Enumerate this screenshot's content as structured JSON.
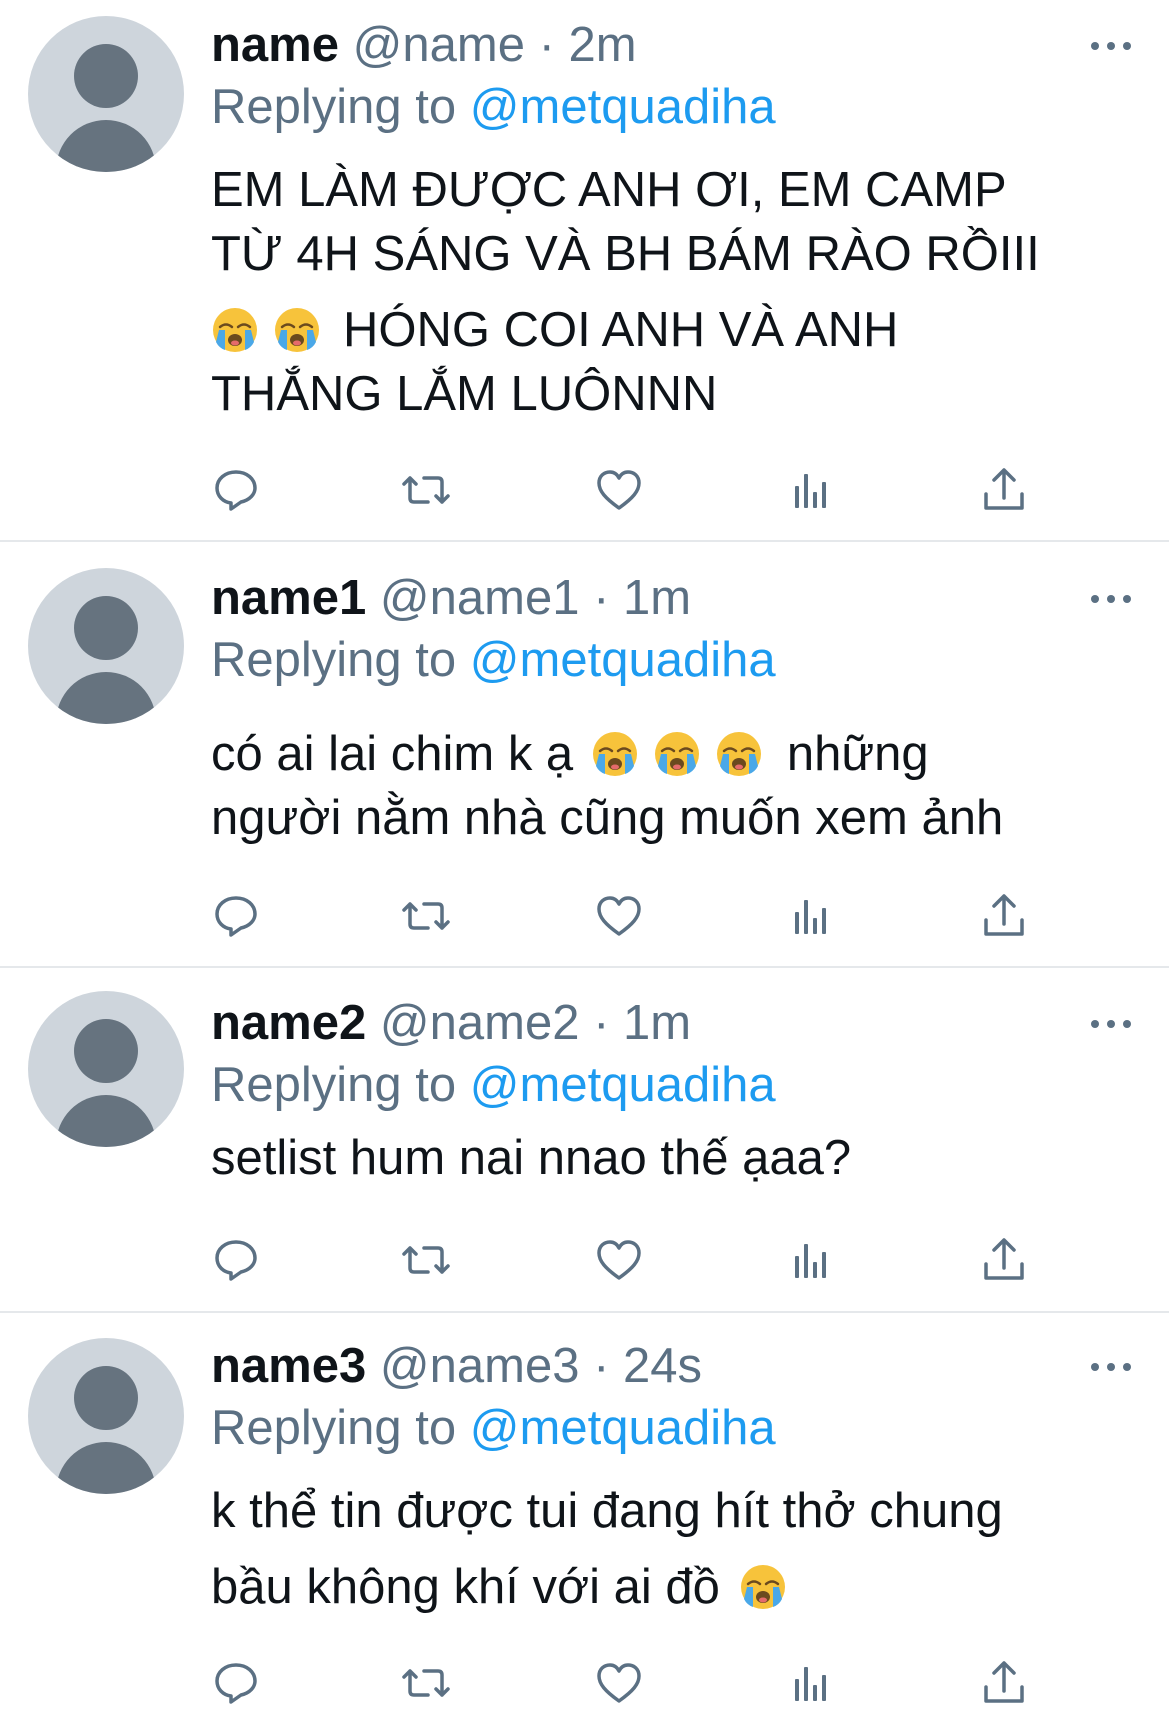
{
  "tweets": [
    {
      "name": "name",
      "handle": "@name",
      "separator": "·",
      "time": "2m",
      "replying_prefix": "Replying to",
      "replying_to": "@metquadiha",
      "text_lines": [
        "EM LÀM ĐƯỢC ANH ƠI, EM CAMP",
        "TỪ 4H SÁNG VÀ BH BÁM RÀO RỒIII",
        "HÓNG COI ANH VÀ ANH",
        "THẮNG LẮM LUÔNNN"
      ]
    },
    {
      "name": "name1",
      "handle": "@name1",
      "separator": "·",
      "time": "1m",
      "replying_prefix": "Replying to",
      "replying_to": "@metquadiha",
      "text_lines": [
        "có ai lai chim k ạ",
        "những",
        "người nằm nhà cũng muốn xem ảnh"
      ]
    },
    {
      "name": "name2",
      "handle": "@name2",
      "separator": "·",
      "time": "1m",
      "replying_prefix": "Replying to",
      "replying_to": "@metquadiha",
      "text_lines": [
        "setlist hum nai nnao thế ạaa?"
      ]
    },
    {
      "name": "name3",
      "handle": "@name3",
      "separator": "·",
      "time": "24s",
      "replying_prefix": "Replying to",
      "replying_to": "@metquadiha",
      "text_lines": [
        "k thể tin được tui đang hít thở chung",
        "bầu không khí với ai đồ"
      ]
    }
  ],
  "icons": {
    "avatar": "default-avatar-icon",
    "more": "more-horizontal-icon",
    "reply": "reply-bubble-icon",
    "retweet": "retweet-icon",
    "like": "heart-icon",
    "views": "analytics-bars-icon",
    "share": "share-upload-icon",
    "emoji": "loudly-crying-face-emoji"
  },
  "colors": {
    "text_primary": "#0f1419",
    "text_secondary": "#5b7083",
    "mention": "#1d9bf0",
    "divider": "#e5e8eb",
    "avatar_bg": "#ced5dc",
    "avatar_fg": "#66737f"
  }
}
